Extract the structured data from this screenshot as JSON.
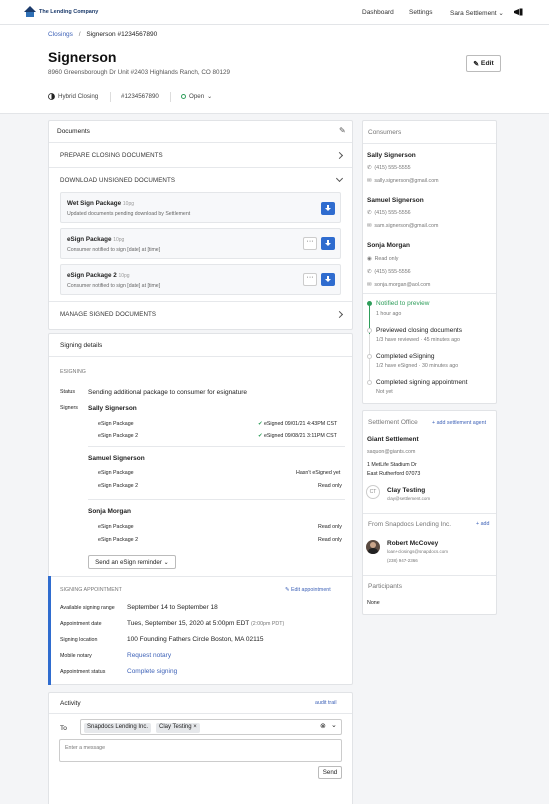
{
  "app": {
    "brand": "The Lending Company"
  },
  "nav": {
    "dashboard": "Dashboard",
    "settings": "Settings",
    "user": "Sara Settlement"
  },
  "breadcrumb": {
    "root": "Closings",
    "current": "Signerson #1234567890"
  },
  "header": {
    "title": "Signerson",
    "address": "8960 Greensborough Dr Unit #2403 Highlands Ranch, CO 80129",
    "edit": "Edit"
  },
  "meta": {
    "closing_type": "Hybrid Closing",
    "id": "#1234567890",
    "status": "Open"
  },
  "documents": {
    "title": "Documents",
    "prepare": "PREPARE CLOSING DOCUMENTS",
    "download": "DOWNLOAD UNSIGNED DOCUMENTS",
    "manage": "MANAGE SIGNED DOCUMENTS",
    "packages": [
      {
        "name": "Wet Sign Package",
        "pages": "10pg",
        "sub": "Updated documents pending download by Settlement"
      },
      {
        "name": "eSign Package",
        "pages": "10pg",
        "sub": "Consumer notified to sign [date] at [time]"
      },
      {
        "name": "eSign Package 2",
        "pages": "10pg",
        "sub": "Consumer notified to sign [date] at [time]"
      }
    ]
  },
  "signing": {
    "title": "Signing details",
    "esigning": "ESIGNING",
    "status_label": "Status",
    "status_value": "Sending additional package to consumer for esignature",
    "signers_label": "Signers",
    "signers": [
      {
        "name": "Sally Signerson",
        "rows": [
          {
            "pkg": "eSign Package",
            "status": "eSigned 09/01/21 4:43PM CST"
          },
          {
            "pkg": "eSign Package 2",
            "status": "eSigned 09/08/21 3:11PM CST"
          }
        ]
      },
      {
        "name": "Samuel Signerson",
        "rows": [
          {
            "pkg": "eSign Package",
            "status": "Hasn't eSigned yet"
          },
          {
            "pkg": "eSign Package 2",
            "status": "Read only"
          }
        ]
      },
      {
        "name": "Sonja Morgan",
        "rows": [
          {
            "pkg": "eSign Package",
            "status": "Read only"
          },
          {
            "pkg": "eSign Package 2",
            "status": "Read only"
          }
        ]
      }
    ],
    "reminder": "Send an eSign reminder"
  },
  "appointment": {
    "title": "SIGNING APPOINTMENT",
    "edit": "Edit appointment",
    "range_label": "Available signing range",
    "range_value": "September 14 to September 18",
    "date_label": "Appointment date",
    "date_value": "Tues, September 15, 2020 at 5:00pm EDT",
    "date_alt": "(2:00pm PDT)",
    "location_label": "Signing location",
    "location_value": "100 Founding Fathers Circle Boston, MA 02115",
    "notary_label": "Mobile notary",
    "notary_value": "Request notary",
    "status_label": "Appointment status",
    "status_value": "Complete signing"
  },
  "activity": {
    "title": "Activity",
    "audit": "audit trail",
    "to_label": "To",
    "chips": [
      "Snapdocs Lending Inc.",
      "Clay Testing"
    ],
    "placeholder": "Enter a message",
    "send": "Send"
  },
  "consumers": {
    "title": "Consumers",
    "people": [
      {
        "name": "Sally Signerson",
        "phone": "(415) 555-5555",
        "email": "sally.signerson@gmail.com"
      },
      {
        "name": "Samuel Signerson",
        "phone": "(415) 555-5556",
        "email": "sam.signerson@gmail.com"
      },
      {
        "name": "Sonja Morgan",
        "readonly": "Read only",
        "phone": "(415) 555-5556",
        "email": "sonja.morgan@aol.com"
      }
    ],
    "timeline": [
      {
        "title": "Notified to preview",
        "sub": "1 hour ago"
      },
      {
        "title": "Previewed closing documents",
        "sub": "1/3 have reviewed · 45 minutes ago"
      },
      {
        "title": "Completed eSigning",
        "sub": "1/2 have eSigned · 30 minutes ago"
      },
      {
        "title": "Completed signing appointment",
        "sub": "Not yet"
      }
    ]
  },
  "settlement": {
    "title": "Settlement Office",
    "add": "+ add settlement agent",
    "company": "Giant Settlement",
    "email": "saquon@giants.com",
    "addr1": "1 MetLife Stadium Dr",
    "addr2": "East Rutherford 07073",
    "agent_initials": "CT",
    "agent_name": "Clay Testing",
    "agent_email": "clay@settlement.com"
  },
  "lender": {
    "title": "From Snapdocs Lending Inc.",
    "add": "+ add",
    "name": "Robert McCovey",
    "email": "loan+closings@snapdocs.com",
    "phone": "(238) 947-2366"
  },
  "participants": {
    "title": "Participants",
    "value": "None"
  },
  "colors": {
    "accent": "#2f6ccf",
    "success": "#2f9e5b",
    "link": "#3f63b8"
  }
}
